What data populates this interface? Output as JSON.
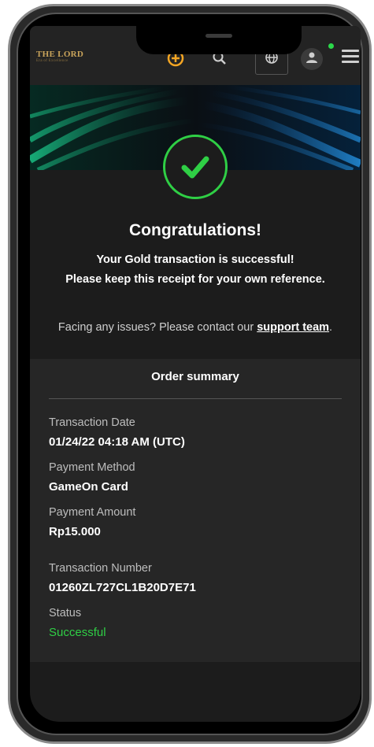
{
  "header": {
    "logo_text": "THE LORD",
    "logo_subtext": "Era of Excellence",
    "icons": [
      "add-coin-icon",
      "search-icon",
      "globe-icon",
      "user-icon",
      "menu-icon"
    ],
    "accent_color": "#f5a623",
    "online_color": "#2bd94a"
  },
  "result": {
    "title": "Congratulations!",
    "line1": "Your Gold transaction is successful!",
    "line2": "Please keep this receipt for your own reference.",
    "issues_prefix": "Facing any issues? Please contact our ",
    "support_link": "support team",
    "issues_suffix": ".",
    "success_color": "#2fcf45"
  },
  "summary": {
    "title": "Order summary",
    "transaction_date_label": "Transaction Date",
    "transaction_date": "01/24/22 04:18 AM (UTC)",
    "payment_method_label": "Payment Method",
    "payment_method": "GameOn Card",
    "payment_amount_label": "Payment Amount",
    "payment_amount": "Rp15.000",
    "transaction_number_label": "Transaction Number",
    "transaction_number": "01260ZL727CL1B20D7E71",
    "status_label": "Status",
    "status": "Successful"
  }
}
